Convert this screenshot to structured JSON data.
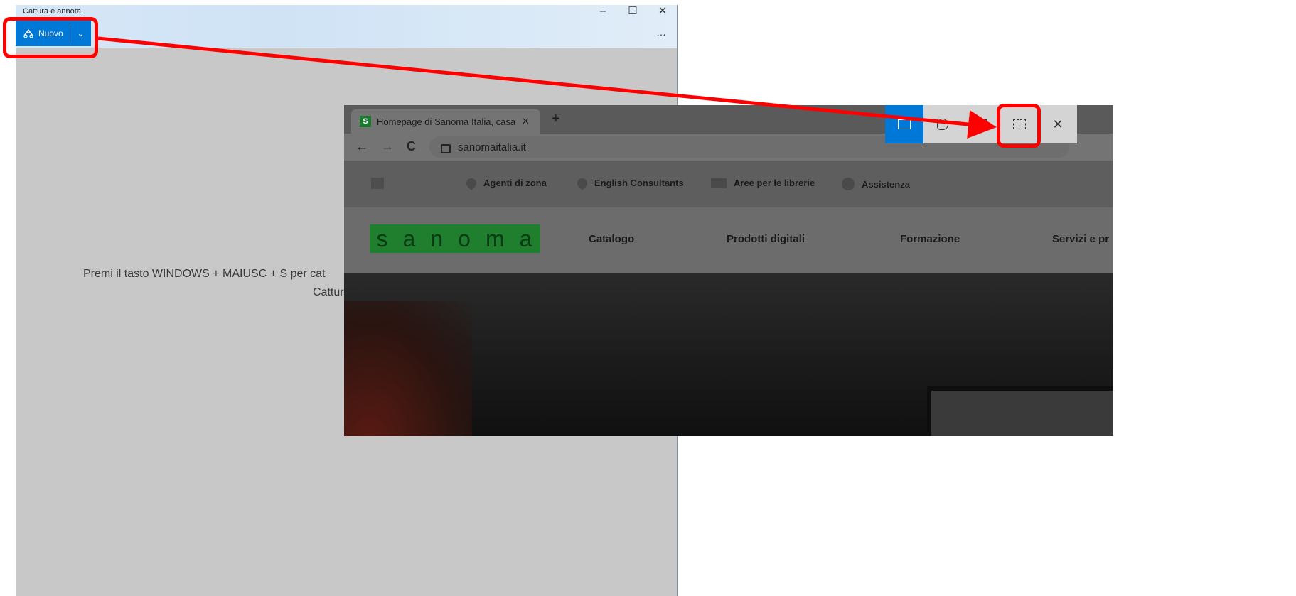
{
  "snip_window": {
    "title": "Cattura e annota",
    "minimize": "–",
    "maximize": "☐",
    "close": "✕",
    "new_button_label": "Nuovo",
    "dropdown_glyph": "⌄",
    "more_glyph": "…",
    "hint_line1": "Premi il tasto WINDOWS + MAIUSC + S per cat",
    "hint_line2": "Cattura e"
  },
  "browser": {
    "tab_favicon": "S",
    "tab_title": "Homepage di Sanoma Italia, casa",
    "tab_close": "✕",
    "new_tab": "+",
    "back": "←",
    "forward": "→",
    "reload": "C",
    "url": "sanomaitalia.it",
    "util_items": [
      "Agenti di zona",
      "English Consultants",
      "Aree per le librerie",
      "Assistenza"
    ],
    "logo_letters": [
      "s",
      "a",
      "n",
      "o",
      "m",
      "a"
    ],
    "menu_items": [
      "Catalogo",
      "Prodotti digitali",
      "Formazione",
      "Servizi e pr"
    ]
  },
  "snip_toolbar": {
    "tools": [
      "rectangular-snip-icon",
      "freeform-snip-icon",
      "window-snip-icon",
      "fullscreen-snip-icon"
    ],
    "close": "✕"
  },
  "colors": {
    "accent": "#0078d7",
    "annotation": "#ff0000",
    "sanoma_green": "#1f7f2e"
  }
}
